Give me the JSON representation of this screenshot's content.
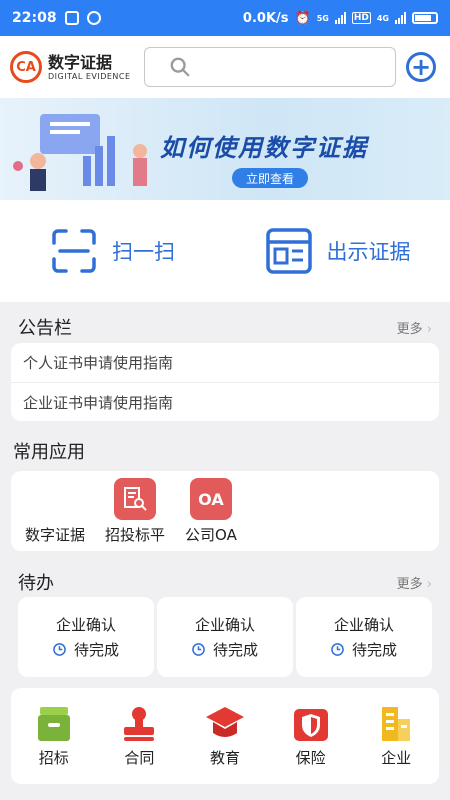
{
  "status_bar": {
    "time": "22:08",
    "net_speed": "0.0K/s",
    "net_5g": "5G",
    "net_4g": "4G",
    "hd": "HD"
  },
  "header": {
    "logo_mark": "CA",
    "logo_title": "数字证据",
    "logo_subtitle": "DIGITAL EVIDENCE",
    "search_icon": "search-icon",
    "add_icon": "plus-circle-icon"
  },
  "banner": {
    "title": "如何使用数字证据",
    "cta": "立即查看"
  },
  "quick_actions": [
    {
      "label": "扫一扫",
      "icon": "scan-icon"
    },
    {
      "label": "出示证据",
      "icon": "id-card-icon"
    }
  ],
  "notice": {
    "title": "公告栏",
    "more": "更多",
    "items": [
      "个人证书申请使用指南",
      "企业证书申请使用指南"
    ]
  },
  "apps": {
    "title": "常用应用",
    "items": [
      {
        "label": "数字证据",
        "icon_text": ""
      },
      {
        "label": "招投标平",
        "icon_text": ""
      },
      {
        "label": "公司OA",
        "icon_text": "OA"
      }
    ]
  },
  "todo": {
    "title": "待办",
    "more": "更多",
    "items": [
      {
        "title": "企业确认",
        "status": "待完成"
      },
      {
        "title": "企业确认",
        "status": "待完成"
      },
      {
        "title": "企业确认",
        "status": "待完成"
      }
    ]
  },
  "categories": [
    {
      "label": "招标",
      "icon": "archive-icon"
    },
    {
      "label": "合同",
      "icon": "stamp-icon"
    },
    {
      "label": "教育",
      "icon": "graduation-cap-icon"
    },
    {
      "label": "保险",
      "icon": "shield-icon"
    },
    {
      "label": "企业",
      "icon": "building-icon"
    }
  ],
  "colors": {
    "status_bar": "#2d7ff6",
    "accent": "#2f6fd6",
    "logo": "#e84a1c",
    "app_red": "#e35a5a",
    "cat_green": "#7bb33a",
    "cat_red": "#e23a32",
    "cat_yellow": "#f2b81f"
  }
}
